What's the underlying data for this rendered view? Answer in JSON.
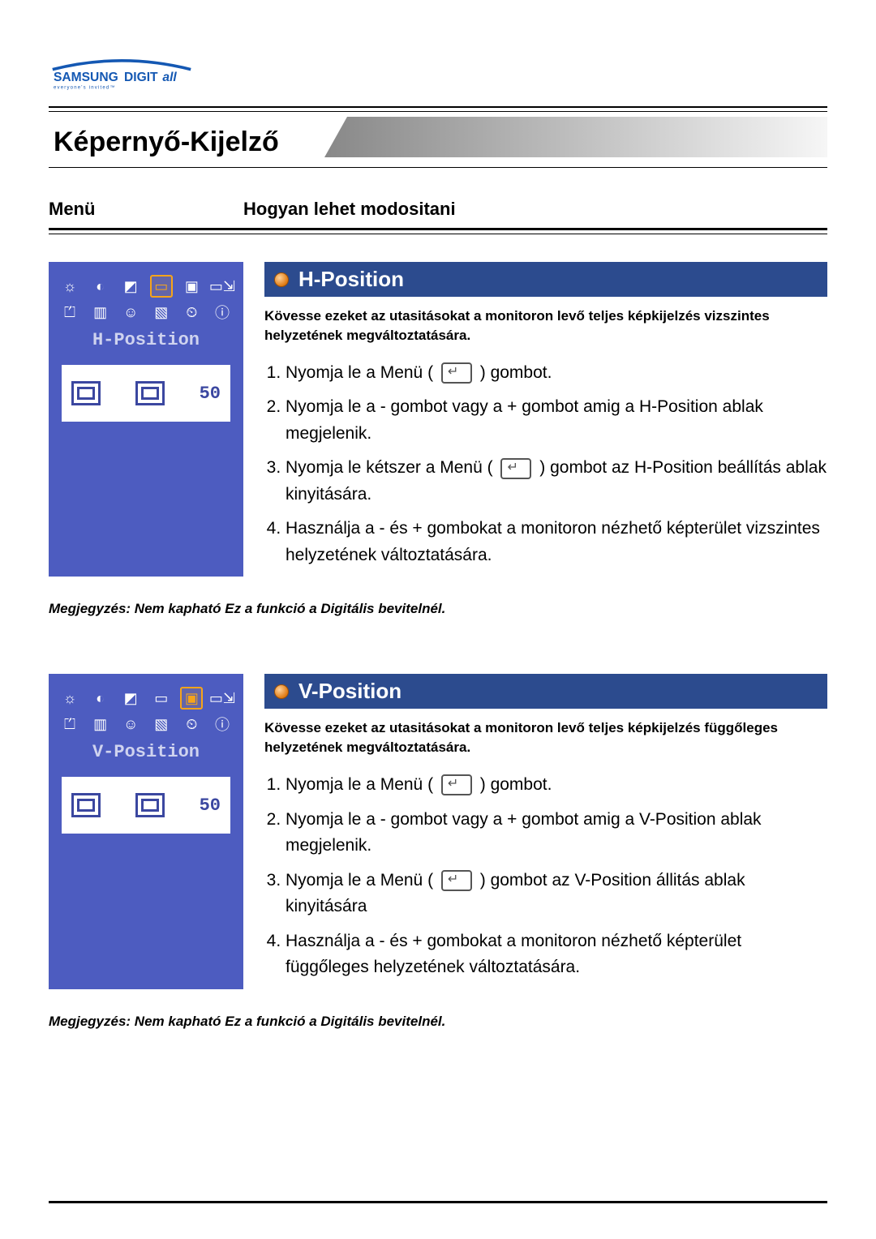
{
  "brand": {
    "line1": "SAMSUNG DIGITall",
    "tagline": "everyone's invited™"
  },
  "page_title": "Képernyő-Kijelző",
  "columns": {
    "menu": "Menü",
    "howto": "Hogyan lehet modositani"
  },
  "sections": [
    {
      "osd_label": "H-Position",
      "osd_value": "50",
      "heading": "H-Position",
      "lead": "Kövesse ezeket az utasitásokat a monitoron levő teljes képkijelzés vizszintes helyzetének megváltoztatására.",
      "steps": [
        {
          "pre": "Nyomja le a Menü  ( ",
          "post": " ) gombot."
        },
        {
          "pre": "Nyomja le a - gombot vagy a + gombot amig a H-Position ablak megjelenik.",
          "post": ""
        },
        {
          "pre": "Nyomja le kétszer a Menü  ( ",
          "post": " ) gombot az H-Position beállítás ablak kinyitására."
        },
        {
          "pre": "Használja a - és + gombokat a monitoron nézhető képterület vizszintes helyzetének változtatására.",
          "post": ""
        }
      ],
      "note": "Megjegyzés: Nem kapható Ez a funkció a Digitális bevitelnél.",
      "selected_icon_index": 3
    },
    {
      "osd_label": "V-Position",
      "osd_value": "50",
      "heading": "V-Position",
      "lead": "Kövesse ezeket az utasitásokat a monitoron levő teljes képkijelzés függőleges helyzetének megváltoztatására.",
      "steps": [
        {
          "pre": "Nyomja le a Menü  ( ",
          "post": " ) gombot."
        },
        {
          "pre": "Nyomja le a - gombot vagy a + gombot amig a V-Position ablak megjelenik.",
          "post": ""
        },
        {
          "pre": "Nyomja le a Menü ( ",
          "post": " ) gombot az V-Position állitás ablak kinyitására"
        },
        {
          "pre": "Használja a - és + gombokat a monitoron nézhető képterület függőleges helyzetének változtatására.",
          "post": ""
        }
      ],
      "note": "Megjegyzés: Nem kapható Ez a funkció a Digitális bevitelnél.",
      "selected_icon_index": 4
    }
  ],
  "osd_icons_row1": [
    "☼",
    "◐",
    "◩",
    "▭",
    "▣",
    "▭⇲"
  ],
  "osd_icons_row2": [
    "⏍",
    "▥",
    "☺",
    "▧",
    "⏲",
    "ⓘ"
  ]
}
